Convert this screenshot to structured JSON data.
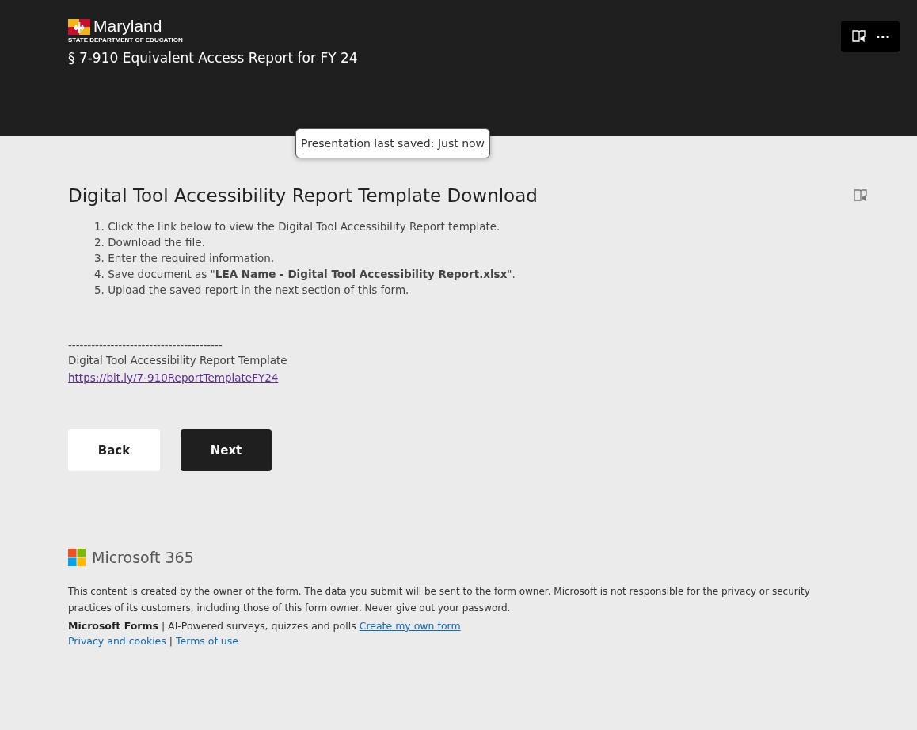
{
  "header": {
    "logo_name": "Maryland",
    "logo_subtitle": "STATE DEPARTMENT OF EDUCATION",
    "form_title": "§ 7-910 Equivalent Access Report for FY 24",
    "menu_button": "···"
  },
  "toast": "Presentation last saved: Just now",
  "section": {
    "title": "Digital Tool Accessibility Report Template Download",
    "steps": [
      "1. Click the link below to view the Digital Tool Accessibility Report template.",
      "2.  Download the file.",
      "3. Enter the required information.",
      "4. Save document as \"**LEA Name - Digital Tool Accessibility Report.xlsx**\".",
      "5. Upload the saved report in the next section of this form."
    ],
    "separator": "----------------------------------------",
    "link_label": "Digital Tool Accessibility Report Template",
    "link": "https://bit.ly/7-910ReportTemplateFY24"
  },
  "buttons": [
    {
      "label": "Back",
      "kind": "secondary"
    },
    {
      "label": "Next",
      "kind": "primary"
    }
  ],
  "footer": {
    "brand": "Microsoft 365",
    "disclaimer": "This content is created by the owner of the form. The data you submit will be sent to the form owner. Microsoft is not responsible for the privacy or security practices of its customers, including those of this form owner. Never give out your password.",
    "product": "Microsoft Forms",
    "tagline": "| AI-Powered surveys, quizzes and polls",
    "create_link": "Create my own form",
    "privacy_link": "Privacy and cookies",
    "divider": "|",
    "terms_link": "Terms of use"
  }
}
